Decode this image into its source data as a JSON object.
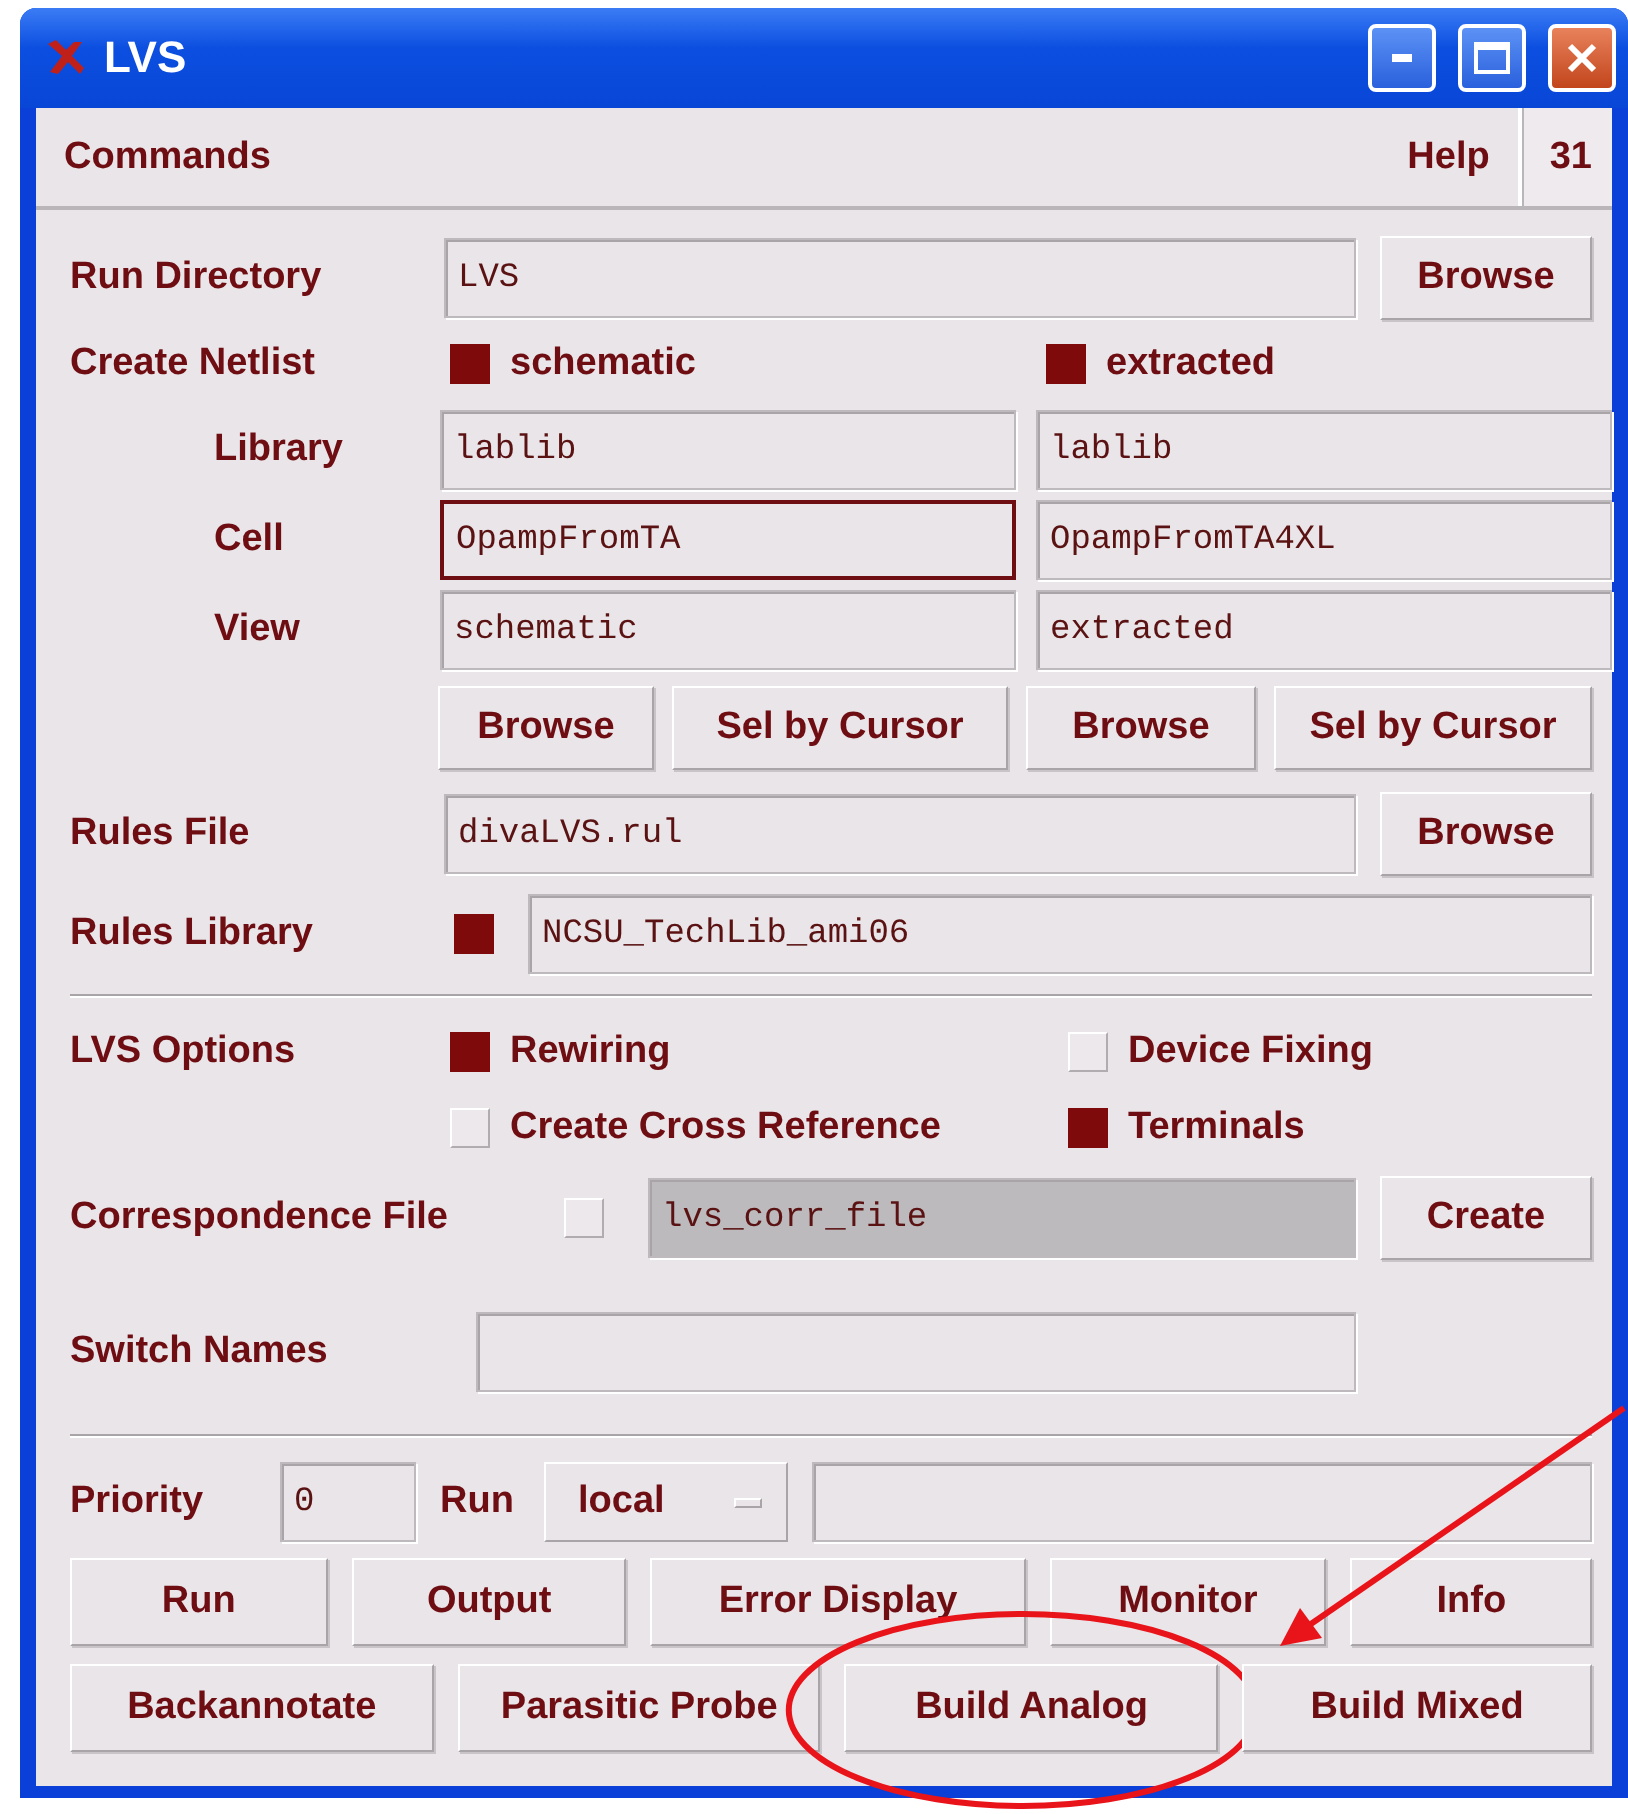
{
  "window": {
    "title": "LVS"
  },
  "menu": {
    "left": "Commands",
    "right": "Help",
    "page": "31"
  },
  "run_directory": {
    "label": "Run Directory",
    "value": "LVS",
    "button": "Browse"
  },
  "create_netlist": {
    "label": "Create Netlist",
    "options": [
      {
        "label": "schematic",
        "checked": true
      },
      {
        "label": "extracted",
        "checked": true
      }
    ]
  },
  "netlist_fields": [
    {
      "label": "Library",
      "fields": [
        {
          "value": "lablib",
          "focused": false
        },
        {
          "value": "lablib",
          "focused": false
        }
      ]
    },
    {
      "label": "Cell",
      "fields": [
        {
          "value": "OpampFromTA",
          "focused": true
        },
        {
          "value": "OpampFromTA4XL",
          "focused": false
        }
      ]
    },
    {
      "label": "View",
      "fields": [
        {
          "value": "schematic",
          "focused": false
        },
        {
          "value": "extracted",
          "focused": false
        }
      ]
    }
  ],
  "netlist_buttons": [
    "Browse",
    "Sel by Cursor",
    "Browse",
    "Sel by Cursor"
  ],
  "rules_file": {
    "label": "Rules File",
    "value": "divaLVS.rul",
    "button": "Browse"
  },
  "rules_library": {
    "label": "Rules Library",
    "checked": true,
    "value": "NCSU_TechLib_ami06"
  },
  "lvs_options": {
    "label": "LVS Options",
    "options": [
      {
        "label": "Rewiring",
        "checked": true
      },
      {
        "label": "Device Fixing",
        "checked": false
      },
      {
        "label": "Create Cross Reference",
        "checked": false
      },
      {
        "label": "Terminals",
        "checked": true
      }
    ]
  },
  "correspondence_file": {
    "label": "Correspondence File",
    "checked": false,
    "value": "lvs_corr_file",
    "disabled": true,
    "button": "Create"
  },
  "switch_names": {
    "label": "Switch Names"
  },
  "priority": {
    "label": "Priority",
    "value": "0"
  },
  "run": {
    "label": "Run",
    "value": "local"
  },
  "action_buttons": [
    [
      {
        "label": "Run",
        "annotated": false
      },
      {
        "label": "Output",
        "annotated": false
      },
      {
        "label": "Error Display",
        "annotated": false
      },
      {
        "label": "Monitor",
        "annotated": false
      },
      {
        "label": "Info",
        "annotated": false
      }
    ],
    [
      {
        "label": "Backannotate",
        "annotated": false
      },
      {
        "label": "Parasitic Probe",
        "annotated": false
      },
      {
        "label": "Build Analog",
        "annotated": true
      },
      {
        "label": "Build Mixed",
        "annotated": false
      }
    ]
  ]
}
